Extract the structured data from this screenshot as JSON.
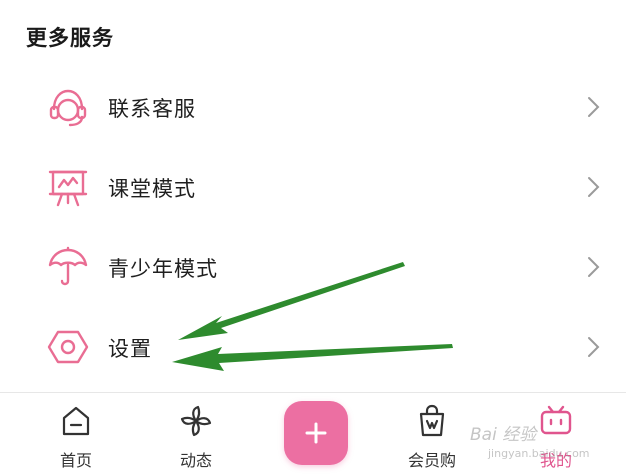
{
  "section": {
    "title": "更多服务"
  },
  "menu": [
    {
      "label": "联系客服",
      "icon": "headset-icon"
    },
    {
      "label": "课堂模式",
      "icon": "whiteboard-icon"
    },
    {
      "label": "青少年模式",
      "icon": "umbrella-icon"
    },
    {
      "label": "设置",
      "icon": "hexagon-settings-icon"
    }
  ],
  "tabbar": {
    "tabs": [
      {
        "label": "首页",
        "icon": "home-icon"
      },
      {
        "label": "动态",
        "icon": "pinwheel-icon"
      },
      {
        "label": "会员购",
        "icon": "shopping-bag-icon"
      },
      {
        "label": "我的",
        "icon": "tv-icon",
        "active": true
      }
    ],
    "fab_icon": "plus-icon"
  },
  "colors": {
    "accent": "#e0558e",
    "icon_pink": "#e96d93",
    "arrow_green": "#2e8b2e"
  },
  "watermark": {
    "text": "Bai 经验",
    "sub": "jingyan.baidu.com"
  }
}
